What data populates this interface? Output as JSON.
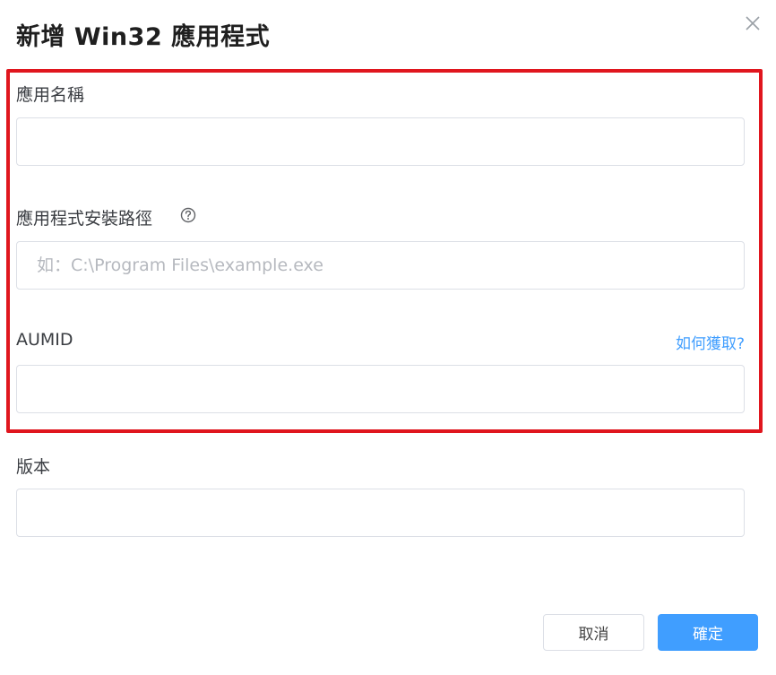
{
  "dialog": {
    "title": "新增 Win32 應用程式",
    "close_icon": "close-icon"
  },
  "form": {
    "app_name": {
      "label": "應用名稱",
      "value": "",
      "placeholder": ""
    },
    "install_path": {
      "label": "應用程式安裝路徑",
      "help_icon": "question-circle-icon",
      "value": "",
      "placeholder": "如：C:\\Program Files\\example.exe"
    },
    "aumid": {
      "label": "AUMID",
      "link": "如何獲取?",
      "value": "",
      "placeholder": ""
    },
    "version": {
      "label": "版本",
      "value": "",
      "placeholder": ""
    }
  },
  "footer": {
    "cancel_label": "取消",
    "confirm_label": "確定"
  },
  "colors": {
    "highlight_border": "#e0161e",
    "primary": "#409eff",
    "input_border": "#dcdfe6"
  }
}
